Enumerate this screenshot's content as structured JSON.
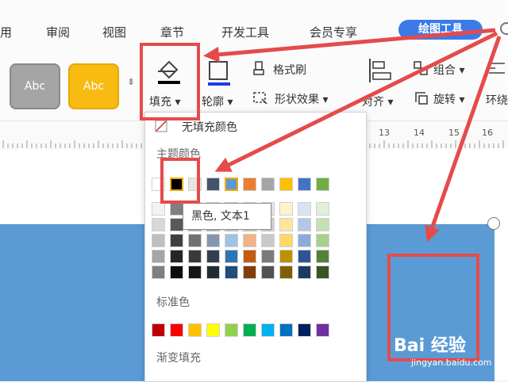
{
  "tabs": {
    "t_use": "用",
    "t_review": "审阅",
    "t_view": "视图",
    "t_chapter": "章节",
    "t_dev": "开发工具",
    "t_member": "会员专享",
    "t_draw": "绘图工具"
  },
  "toolbar": {
    "style1": "Abc",
    "style2": "Abc",
    "fill": "填充",
    "outline": "轮廓",
    "format_painter": "格式刷",
    "shape_effect": "形状效果",
    "combine": "组合",
    "align": "对齐",
    "rotate": "旋转",
    "wrap": "环绕"
  },
  "ruler": [
    "13",
    "14",
    "15",
    "16"
  ],
  "fill_panel": {
    "no_fill": "无填充颜色",
    "theme_colors": "主题颜色",
    "standard_colors": "标准色",
    "gradient_fill": "渐变填充",
    "tooltip": "黑色, 文本1",
    "theme_top": [
      "#ffffff",
      "#000000",
      "#e7e6e6",
      "#44546a",
      "#5b9bd5",
      "#ed7d31",
      "#a5a5a5",
      "#ffc000",
      "#4472c4",
      "#70ad47"
    ],
    "theme_shades": [
      [
        "#f2f2f2",
        "#7f7f7f",
        "#d0cece",
        "#d6dce4",
        "#deebf6",
        "#fbe5d5",
        "#ededed",
        "#fff2cc",
        "#dae3f3",
        "#e2efd9"
      ],
      [
        "#d8d8d8",
        "#595959",
        "#aeabab",
        "#adb9ca",
        "#bdd7ee",
        "#f8cbad",
        "#dbdbdb",
        "#fee599",
        "#b4c7e7",
        "#c5e0b3"
      ],
      [
        "#bfbfbf",
        "#3f3f3f",
        "#757070",
        "#8496b0",
        "#9dc3e6",
        "#f4b183",
        "#c9c9c9",
        "#ffd965",
        "#8eaadb",
        "#a8d08d"
      ],
      [
        "#a5a5a5",
        "#262626",
        "#3a3838",
        "#323f4f",
        "#2e75b5",
        "#c55a11",
        "#7b7b7b",
        "#bf9000",
        "#2f5496",
        "#538135"
      ],
      [
        "#7f7f7f",
        "#0c0c0c",
        "#171616",
        "#222a35",
        "#1e4e79",
        "#833c0b",
        "#525252",
        "#7f6000",
        "#1f3864",
        "#375623"
      ]
    ],
    "standard": [
      "#c00000",
      "#ff0000",
      "#ffc000",
      "#ffff00",
      "#92d050",
      "#00b050",
      "#00b0f0",
      "#0070c0",
      "#002060",
      "#7030a0"
    ]
  },
  "watermark": {
    "brand": "Bai 经验",
    "url": "jingyan.baidu.com"
  },
  "colors": {
    "accent_red": "#e54b4b",
    "shape_blue": "#5b9bd5",
    "tab_blue": "#3b7ae8"
  }
}
